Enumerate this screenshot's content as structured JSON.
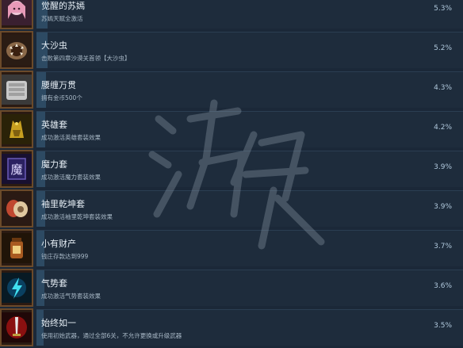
{
  "achievements": [
    {
      "title": "觉醒的苏嫣",
      "desc": "苏嫣天赋全激活",
      "percent": "5.3%",
      "fill": 0.053,
      "icon": "awakened-girl-icon"
    },
    {
      "title": "大沙虫",
      "desc": "击败第四章沙漠关首领【大沙虫】",
      "percent": "5.2%",
      "fill": 0.052,
      "icon": "sandworm-icon"
    },
    {
      "title": "腰缠万贯",
      "desc": "拥有金币500个",
      "percent": "4.3%",
      "fill": 0.043,
      "icon": "coin-pile-icon"
    },
    {
      "title": "英雄套",
      "desc": "成功激活英雄套装效果",
      "percent": "4.2%",
      "fill": 0.042,
      "icon": "hero-set-icon"
    },
    {
      "title": "魔力套",
      "desc": "成功激活魔力套装效果",
      "percent": "3.9%",
      "fill": 0.039,
      "icon": "magic-set-icon"
    },
    {
      "title": "袖里乾坤套",
      "desc": "成功激活袖里乾坤套装效果",
      "percent": "3.9%",
      "fill": 0.039,
      "icon": "sleeve-set-icon"
    },
    {
      "title": "小有财产",
      "desc": "钱庄存款达到999",
      "percent": "3.7%",
      "fill": 0.037,
      "icon": "money-jar-icon"
    },
    {
      "title": "气势套",
      "desc": "成功激活气势套装效果",
      "percent": "3.6%",
      "fill": 0.036,
      "icon": "momentum-set-icon"
    },
    {
      "title": "始终如一",
      "desc": "使用初始武器，通过全部6关，不允许更换或升级武器",
      "percent": "3.5%",
      "fill": 0.035,
      "icon": "initial-weapon-icon"
    }
  ],
  "colors": {
    "bar": "#2d4a63",
    "panel": "#1e2c3c",
    "background": "#1b2838"
  }
}
